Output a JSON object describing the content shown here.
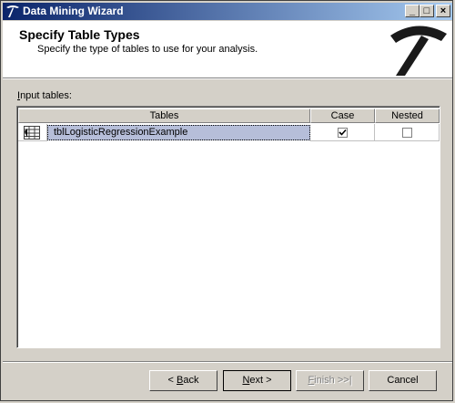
{
  "window": {
    "title": "Data Mining Wizard",
    "controls": {
      "minimize": "_",
      "maximize": "□",
      "close": "×"
    }
  },
  "header": {
    "title": "Specify Table Types",
    "subtitle": "Specify the type of tables to use for your analysis.",
    "logo_icon": "pickaxe-icon"
  },
  "input_tables": {
    "label": "Input tables:",
    "columns": [
      "Tables",
      "Case",
      "Nested"
    ],
    "rows": [
      {
        "table": "tblLogisticRegressionExample",
        "case": true,
        "nested": false
      }
    ]
  },
  "buttons": {
    "back": {
      "prefix": "< ",
      "key": "B",
      "rest": "ack"
    },
    "next": {
      "key": "N",
      "rest": "ext >"
    },
    "finish": {
      "key": "F",
      "rest": "inish >>|"
    },
    "cancel": "Cancel"
  },
  "colors": {
    "titlebar_start": "#0a246a",
    "titlebar_end": "#a6caf0",
    "selection": "#b6bed9"
  }
}
